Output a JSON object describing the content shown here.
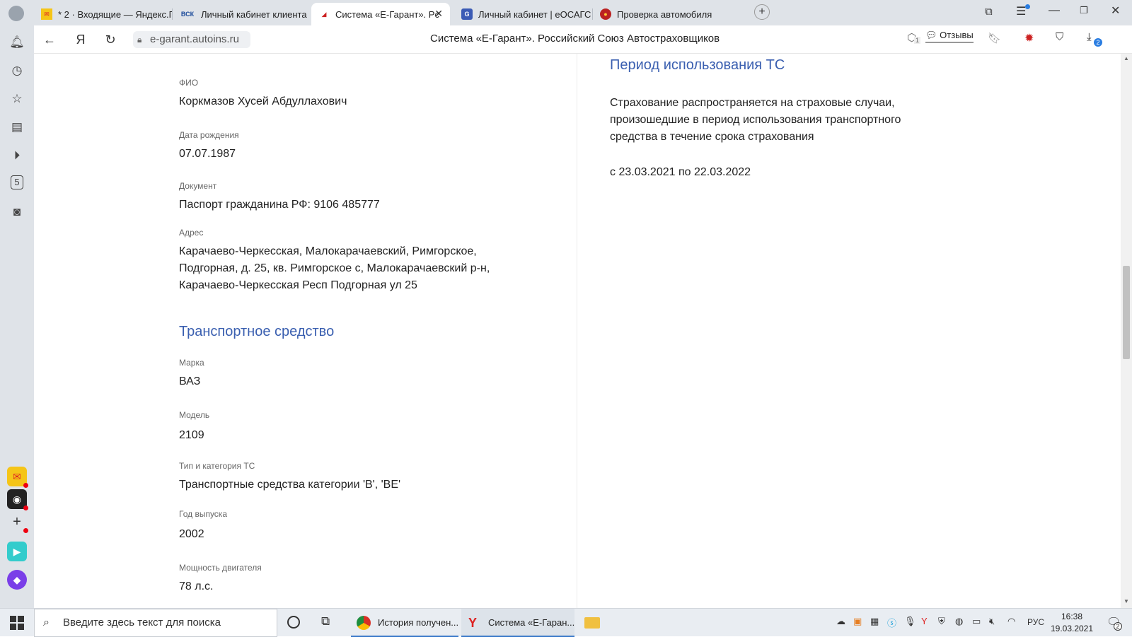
{
  "browser": {
    "tabs": [
      {
        "label": "* 2 · Входящие — Яндекс.П",
        "icon": "mail-icon"
      },
      {
        "label": "Личный кабинет клиента",
        "icon": "vsk-icon",
        "icon_text": "ВСК"
      },
      {
        "label": "Система «Е-Гарант». Рс",
        "icon": "egarant-icon",
        "active": true
      },
      {
        "label": "Личный кабинет | еОСАГС",
        "icon": "shield-icon"
      },
      {
        "label": "Проверка автомобиля",
        "icon": "gibdd-icon"
      }
    ],
    "url": "e-garant.autoins.ru",
    "page_title": "Система «Е-Гарант». Российский Союз Автостраховщиков",
    "reviews_label": "Отзывы",
    "yandex_glyph": "Я",
    "download_badge": "2",
    "extension_badge": "1"
  },
  "person": {
    "fio_label": "ФИО",
    "fio": "Коркмазов Хусей Абдуллахович",
    "dob_label": "Дата рождения",
    "dob": "07.07.1987",
    "doc_label": "Документ",
    "doc": "Паспорт гражданина РФ: 9106 485777",
    "address_label": "Адрес",
    "address_line1": "Карачаево-Черкесская, Малокарачаевский, Римгорское,",
    "address_line2": "Подгорная, д. 25, кв. Римгорское с, Малокарачаевский р-н,",
    "address_line3": "Карачаево-Черкесская Респ Подгорная ул 25"
  },
  "vehicle": {
    "heading": "Транспортное средство",
    "brand_label": "Марка",
    "brand": "ВАЗ",
    "model_label": "Модель",
    "model": "2109",
    "type_label": "Тип и категория ТС",
    "type": "Транспортные средства категории 'B', 'BE'",
    "year_label": "Год выпуска",
    "year": "2002",
    "power_label": "Мощность двигателя",
    "power": "78 л.с."
  },
  "period": {
    "heading": "Период использования ТС",
    "text_line1": "Страхование распространяется на страховые случаи,",
    "text_line2": "произошедшие в период использования транспортного",
    "text_line3": "средства в течение срока страхования",
    "range": "с 23.03.2021 по 22.03.2022"
  },
  "taskbar": {
    "search_placeholder": "Введите здесь текст для поиска",
    "apps": [
      {
        "label": "История получен...",
        "icon": "chrome-icon"
      },
      {
        "label": "Система «Е-Гаран...",
        "icon": "yandex-browser-icon"
      }
    ],
    "lang": "РУС",
    "time": "16:38",
    "date": "19.03.2021",
    "notif_count": "2"
  }
}
